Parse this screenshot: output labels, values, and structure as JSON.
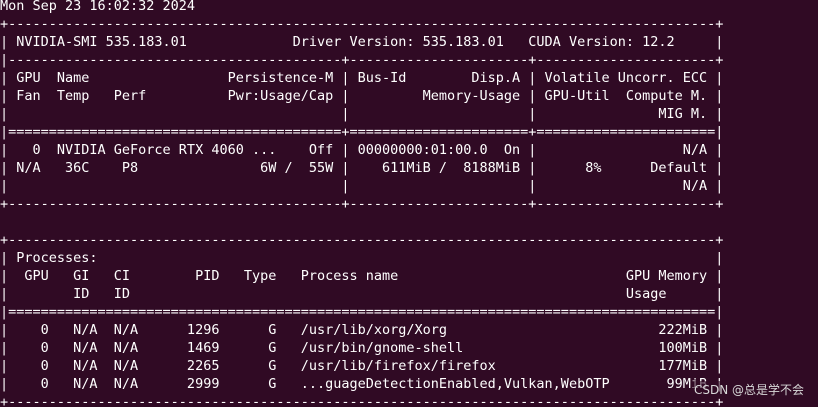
{
  "terminal": {
    "lines": [
      "Mon Sep 23 16:02:32 2024",
      "+---------------------------------------------------------------------------------------+",
      "| NVIDIA-SMI 535.183.01             Driver Version: 535.183.01   CUDA Version: 12.2     |",
      "|-----------------------------------------+----------------------+----------------------+",
      "| GPU  Name                 Persistence-M | Bus-Id        Disp.A | Volatile Uncorr. ECC |",
      "| Fan  Temp   Perf          Pwr:Usage/Cap |         Memory-Usage | GPU-Util  Compute M. |",
      "|                                         |                      |               MIG M. |",
      "|=========================================+======================+======================|",
      "|   0  NVIDIA GeForce RTX 4060 ...    Off | 00000000:01:00.0  On |                  N/A |",
      "| N/A   36C    P8               6W /  55W |    611MiB /  8188MiB |      8%      Default |",
      "|                                         |                      |                  N/A |",
      "+-----------------------------------------+----------------------+----------------------+",
      "",
      "+---------------------------------------------------------------------------------------+",
      "| Processes:                                                                            |",
      "|  GPU   GI   CI        PID   Type   Process name                            GPU Memory |",
      "|        ID   ID                                                             Usage      |",
      "|=======================================================================================|",
      "|    0   N/A  N/A      1296      G   /usr/lib/xorg/Xorg                          222MiB |",
      "|    0   N/A  N/A      1469      G   /usr/bin/gnome-shell                        100MiB |",
      "|    0   N/A  N/A      2265      G   /usr/lib/firefox/firefox                    177MiB |",
      "|    0   N/A  N/A      2999      G   ...guageDetectionEnabled,Vulkan,WebOTP       99MiB |",
      "+---------------------------------------------------------------------------------------+"
    ]
  },
  "watermark": "CSDN @总是学不会",
  "colors": {
    "background": "#300a24",
    "foreground": "#ffffff"
  }
}
